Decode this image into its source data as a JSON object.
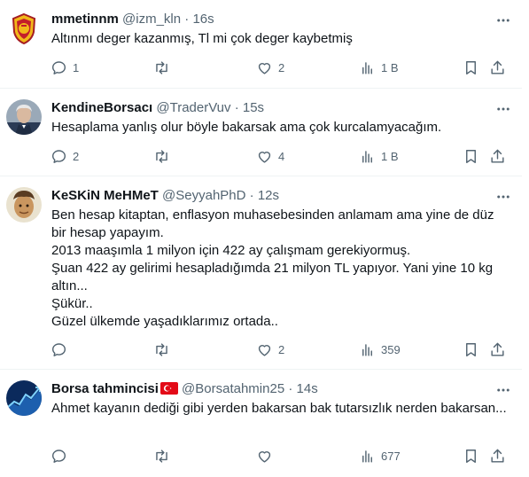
{
  "tweets": [
    {
      "name": "mmetinnm",
      "handle": "@izm_kln",
      "separator": "·",
      "time": "16s",
      "text": "Altınmı deger kazanmış, Tl mi çok deger kaybetmiş",
      "replies": "1",
      "retweets": "",
      "likes": "2",
      "views": "1 B"
    },
    {
      "name": "KendineBorsacı",
      "handle": "@TraderVuv",
      "separator": "·",
      "time": "15s",
      "text": "Hesaplama yanlış olur böyle bakarsak ama çok kurcalamyacağım.",
      "replies": "2",
      "retweets": "",
      "likes": "4",
      "views": "1 B"
    },
    {
      "name": "KeSKiN MeHMeT",
      "handle": "@SeyyahPhD",
      "separator": "·",
      "time": "12s",
      "text": "Ben hesap kitaptan, enflasyon muhasebesinden anlamam ama yine de düz bir hesap yapayım.\n2013 maaşımla 1 milyon için 422 ay çalışmam gerekiyormuş.\nŞuan 422 ay gelirimi hesapladığımda 21 milyon TL yapıyor. Yani yine 10 kg altın...\nŞükür..\nGüzel ülkemde yaşadıklarımız ortada..",
      "replies": "",
      "retweets": "",
      "likes": "2",
      "views": "359"
    },
    {
      "name": "Borsa tahmincisi",
      "handle": "@Borsatahmin25",
      "separator": "·",
      "time": "14s",
      "text": "Ahmet kayanın dediği gibi yerden bakarsan bak tutarsızlık nerden bakarsan...",
      "replies": "",
      "retweets": "",
      "likes": "",
      "views": "677"
    }
  ],
  "colors": {
    "text": "#0f1419",
    "muted": "#536471",
    "divider": "#eff3f4"
  },
  "icons": [
    "reply-icon",
    "retweet-icon",
    "like-icon",
    "views-icon",
    "bookmark-icon",
    "share-icon",
    "more-icon",
    "turkish-flag-icon"
  ]
}
